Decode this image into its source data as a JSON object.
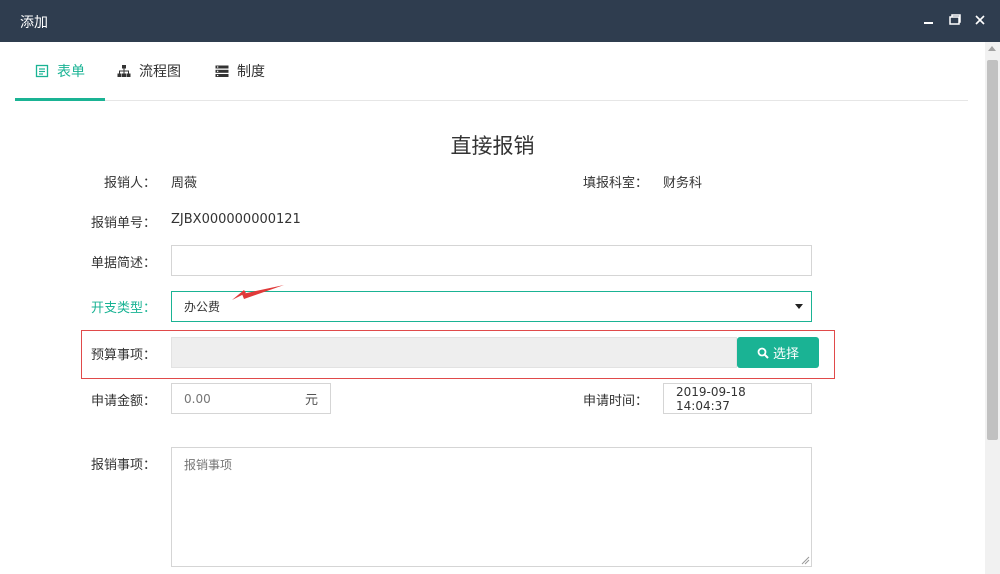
{
  "window": {
    "title": "添加"
  },
  "tabs": [
    {
      "label": "表单",
      "icon": "form-icon",
      "active": true
    },
    {
      "label": "流程图",
      "icon": "sitemap-icon",
      "active": false
    },
    {
      "label": "制度",
      "icon": "list-icon",
      "active": false
    }
  ],
  "form": {
    "title": "直接报销",
    "applicant_label": "报销人：",
    "applicant_value": "周薇",
    "dept_label": "填报科室：",
    "dept_value": "财务科",
    "number_label": "报销单号：",
    "number_value": "ZJBX000000000121",
    "desc_label": "单据简述：",
    "desc_value": "",
    "expense_type_label": "开支类型：",
    "expense_type_value": "办公费",
    "budget_label": "预算事项：",
    "budget_value": "",
    "select_button": "选择",
    "amount_label": "申请金额：",
    "amount_placeholder": "0.00",
    "amount_unit": "元",
    "time_label": "申请时间：",
    "time_value": "2019-09-18 14:04:37",
    "matter_label": "报销事项：",
    "matter_placeholder": "报销事项"
  },
  "colors": {
    "accent": "#1ab394",
    "titlebar": "#2f3d4f",
    "highlight": "#e04a4a"
  }
}
